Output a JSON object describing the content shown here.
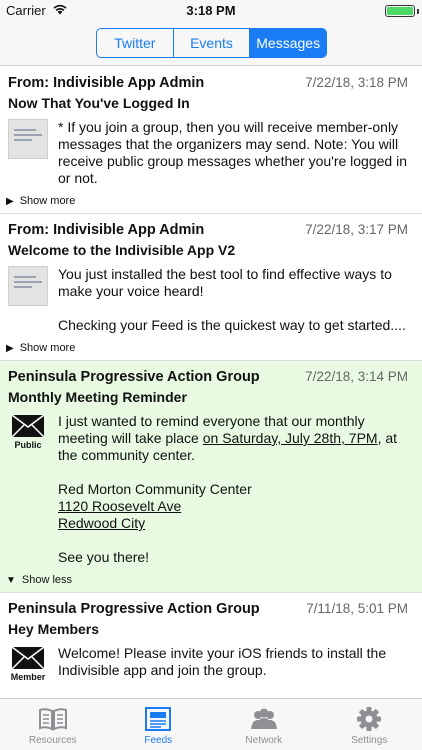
{
  "status_bar": {
    "carrier": "Carrier",
    "time": "3:18 PM"
  },
  "segments": [
    {
      "label": "Twitter",
      "active": false
    },
    {
      "label": "Events",
      "active": false
    },
    {
      "label": "Messages",
      "active": true
    }
  ],
  "messages": [
    {
      "from": "From: Indivisible App Admin",
      "date": "7/22/18, 3:18 PM",
      "subject": "Now That You've Logged In",
      "body": "* If you join a group, then you will receive member-only messages that the organizers may send. Note: You will receive public group messages whether you're logged in or not.",
      "toggle": "Show more"
    },
    {
      "from": "From: Indivisible App Admin",
      "date": "7/22/18, 3:17 PM",
      "subject": "Welcome to the Indivisible App V2",
      "body_1": "You just installed the best tool to find effective ways to make your voice heard!",
      "body_2": "Checking your Feed is the quickest way to get started....",
      "toggle": "Show more"
    },
    {
      "from": "Peninsula Progressive Action Group",
      "date": "7/22/18, 3:14 PM",
      "subject": "Monthly Meeting Reminder",
      "icon_label": "Public",
      "body_1a": "I just wanted to remind everyone that our monthly meeting will take place ",
      "body_1b": "on Saturday, July 28th, 7PM",
      "body_1c": ", at the community center.",
      "address_name": "Red Morton Community Center",
      "address_street": "1120 Roosevelt Ave",
      "address_city": "Redwood City",
      "closing": "See you there!",
      "toggle": "Show less"
    },
    {
      "from": "Peninsula Progressive Action Group",
      "date": "7/11/18, 5:01 PM",
      "subject": "Hey Members",
      "icon_label": "Member",
      "body": "Welcome! Please invite your iOS friends to install the Indivisible app and join the group."
    }
  ],
  "tabs": [
    {
      "label": "Resources",
      "icon": "book-icon",
      "active": false
    },
    {
      "label": "Feeds",
      "icon": "newspaper-icon",
      "active": true
    },
    {
      "label": "Network",
      "icon": "people-icon",
      "active": false
    },
    {
      "label": "Settings",
      "icon": "gear-icon",
      "active": false
    }
  ],
  "colors": {
    "accent": "#1a7cf5",
    "highlight": "#e9fae2",
    "inactive": "#8e8e93"
  }
}
